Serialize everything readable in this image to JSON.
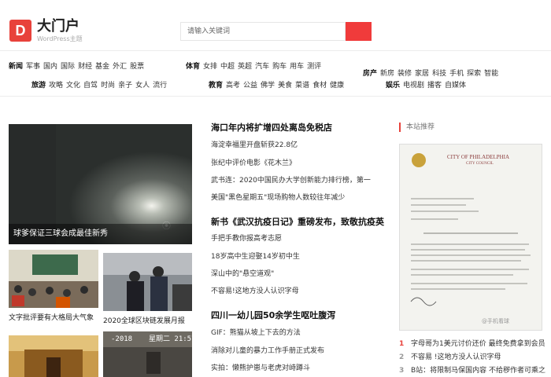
{
  "header": {
    "logo_letter": "D",
    "site_name": "大门户",
    "site_sub": "WordPress主题",
    "search_placeholder": "请输入关键词"
  },
  "nav": {
    "row1a": [
      "新闻",
      "军事",
      "国内",
      "国际",
      "财经",
      "基金",
      "外汇",
      "股票"
    ],
    "row1b": [
      "体育",
      "女排",
      "中超",
      "英超",
      "汽车",
      "购车",
      "用车",
      "测评"
    ],
    "row1c": [
      "房产",
      "新房",
      "装修",
      "家居",
      "科技",
      "手机",
      "探索",
      "智能"
    ],
    "row2a": [
      "旅游",
      "攻略",
      "文化",
      "自驾",
      "时尚",
      "亲子",
      "女人",
      "流行"
    ],
    "row2b": [
      "教育",
      "高考",
      "公益",
      "佛学",
      "美食",
      "菜谱",
      "食材",
      "健康"
    ],
    "row2c": [
      "娱乐",
      "电视剧",
      "播客",
      "自媒体"
    ]
  },
  "feature": {
    "caption": "球爹保证三球会成最佳新秀"
  },
  "thumbs": [
    {
      "caption": "文字批评要有大格局大气象"
    },
    {
      "caption": "2020全球区块链发展月报"
    }
  ],
  "news_groups": [
    {
      "headline": "海口年内将扩增四处离岛免税店",
      "items": [
        "海淀幸福里开盘斩获22.8亿",
        "张纪中评价电影《花木兰》",
        "武书连：2020中国民办大学创新能力排行榜，第一",
        "美国\"黑色星期五\"现场购物人数较往年减少"
      ]
    },
    {
      "headline": "新书《武汉抗疫日记》重磅发布，致敬抗疫英",
      "items": [
        "手把手教你报高考志愿",
        "18岁高中生迎娶14岁初中生",
        "深山中的\"悬空道观\"",
        "不容易!这地方没人认识字母"
      ]
    },
    {
      "headline": "四川一幼儿园50余学生呕吐腹泻",
      "items": [
        "GIF：熊猫从坡上下去的方法",
        "消除对儿童的暴力工作手册正式发布",
        "实拍：懒熊护崽与老虎对峙蹲斗"
      ]
    }
  ],
  "sidebar": {
    "title": "本站推荐",
    "letter": {
      "heading": "CITY OF PHILADELPHIA",
      "sub": "CITY COUNCIL",
      "watermark": "@手机看球"
    },
    "ranked": [
      {
        "num": "1",
        "text": "字母哥为1美元讨价还价 最终免费拿到会员"
      },
      {
        "num": "2",
        "text": "不容易 !这地方没人认识字母"
      },
      {
        "num": "3",
        "text": "B站：将限制马保国内容 不给秽作者可乘之"
      }
    ]
  },
  "colors": {
    "accent": "#e8423b",
    "search": "#f03b3b"
  }
}
